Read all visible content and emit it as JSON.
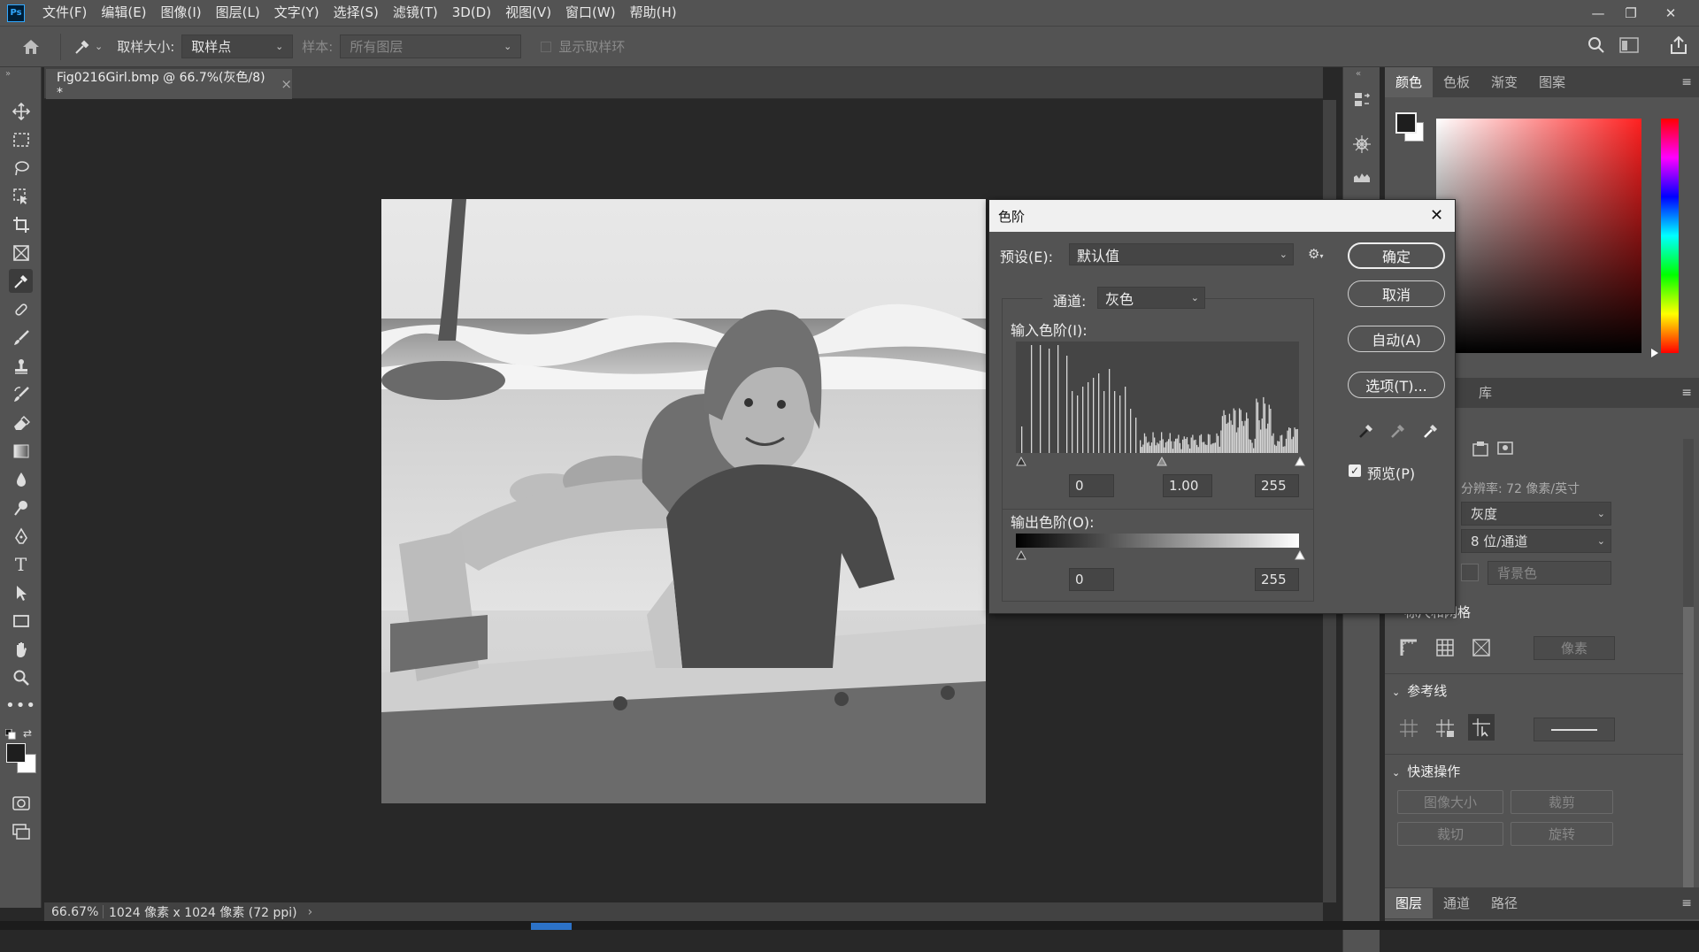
{
  "app": {
    "logo": "Ps"
  },
  "menu": [
    "文件(F)",
    "编辑(E)",
    "图像(I)",
    "图层(L)",
    "文字(Y)",
    "选择(S)",
    "滤镜(T)",
    "3D(D)",
    "视图(V)",
    "窗口(W)",
    "帮助(H)"
  ],
  "window_controls": {
    "minimize": "—",
    "restore": "❐",
    "close": "✕"
  },
  "options": {
    "sample_size_label": "取样大小:",
    "sample_size_value": "取样点",
    "sample_label": "样本:",
    "sample_value": "所有图层",
    "show_ring_label": "显示取样环"
  },
  "document": {
    "tab_title": "Fig0216Girl.bmp @ 66.7%(灰色/8) *",
    "close": "×"
  },
  "status": {
    "zoom": "66.67%",
    "info": "1024 像素 x 1024 像素 (72 ppi)",
    "arrow": "›"
  },
  "panels": {
    "color_tabs": [
      "颜色",
      "色板",
      "渐变",
      "图案"
    ],
    "properties_tabs_visible": [
      "库"
    ],
    "resolution": "分辨率: 72 像素/英寸",
    "mode": "灰度",
    "depth": "8 位/通道",
    "background": "背景色",
    "grid_header": "标尺和网格",
    "grid_unit": "像素",
    "guides_header": "参考线",
    "quick_header": "快速操作",
    "quick_actions": [
      "图像大小",
      "裁剪",
      "裁切",
      "旋转"
    ],
    "bottom_tabs": [
      "图层",
      "通道",
      "路径"
    ]
  },
  "levels_dialog": {
    "title": "色阶",
    "preset_label": "预设(E):",
    "preset_value": "默认值",
    "channel_label": "通道:",
    "channel_value": "灰色",
    "input_label": "输入色阶(I):",
    "input_black": "0",
    "input_gamma": "1.00",
    "input_white": "255",
    "output_label": "输出色阶(O):",
    "output_black": "0",
    "output_white": "255",
    "buttons": {
      "ok": "确定",
      "cancel": "取消",
      "auto": "自动(A)",
      "options": "选项(T)..."
    },
    "preview_label": "预览(P)",
    "preview_checked": true
  },
  "colors": {
    "accent": "#31a8ff",
    "panel": "#535353",
    "canvas": "#282828",
    "foreground": "#1e1e1e",
    "background": "#ffffff"
  }
}
